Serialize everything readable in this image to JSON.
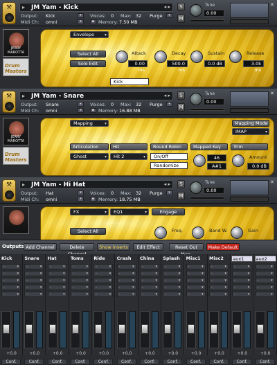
{
  "instruments": [
    {
      "title": "JM Yam - Kick",
      "output": "Kick",
      "midi_ch": "omni",
      "voices": "0",
      "max": "32",
      "purge": "Purge",
      "memory": "7.50 MB",
      "tune_label": "Tune",
      "tune_value": "0.00",
      "tab": "Envelope",
      "select_all": "Select All",
      "solo_edit": "Solo Edit",
      "slot_name": "Kick",
      "knobs": [
        {
          "label": "Attack",
          "value": "0.00 ms"
        },
        {
          "label": "Decay",
          "value": "500.0 ms"
        },
        {
          "label": "Sustain",
          "value": "0.0 dB"
        },
        {
          "label": "Release",
          "value": "3.0k ms"
        }
      ]
    },
    {
      "title": "JM Yam - Snare",
      "output": "Snare",
      "midi_ch": "omni",
      "voices": "0",
      "max": "32",
      "purge": "Purge",
      "memory": "16.88 MB",
      "tune_label": "Tune",
      "tune_value": "0.00",
      "tab": "Mapping",
      "mapping_mode_label": "Mapping Mode",
      "mapping_mode_value": "IMAP",
      "articulation_label": "Articulation",
      "articulation_value": "Ghost",
      "hit_label": "Hit",
      "hit_value": "Hit 2",
      "round_robin_label": "Round Robin",
      "on_off": "On/Off",
      "randomize": "Randomize",
      "mapped_key_label": "Mapped Key",
      "mapped_key_value": "46",
      "mapped_key_note": "A#1",
      "trim_label": "Trim",
      "trim_amount_label": "Amount",
      "trim_value": "0.0 dB"
    },
    {
      "title": "JM Yam - Hi Hat",
      "output": "Hat",
      "midi_ch": "omni",
      "voices": "0",
      "max": "32",
      "purge": "Purge",
      "memory": "18.75 MB",
      "tune_label": "Tune",
      "tune_value": "0.00",
      "fx_label": "FX",
      "fx_value": "EQ1",
      "engage": "Engage",
      "select_all": "Select All",
      "freq": "Freq.",
      "band_w": "Band W.",
      "gain": "Gain"
    }
  ],
  "header_labels": {
    "output": "Output:",
    "midi": "Midi Ch:",
    "voices": "Voices:",
    "max": "Max:",
    "memory": "Memory:",
    "s": "S",
    "m": "M"
  },
  "picture": {
    "caption1": "JERRY",
    "caption2": "MAROTTA",
    "logo_text": "Drum Masters"
  },
  "mixer": {
    "title": "Outputs",
    "buttons": [
      "Add Channel",
      "Delete Channel",
      "Show Inserts",
      "Edit Effect",
      "Reset Out Map.",
      "Make Default"
    ],
    "channels": [
      {
        "name": "Kick",
        "vol": "+0.0",
        "conf": "Conf."
      },
      {
        "name": "Snare",
        "vol": "+0.0",
        "conf": "Conf."
      },
      {
        "name": "Hat",
        "vol": "+0.0",
        "conf": "Conf."
      },
      {
        "name": "Toms",
        "vol": "+0.0",
        "conf": "Conf."
      },
      {
        "name": "Ride",
        "vol": "+0.0",
        "conf": "Conf."
      },
      {
        "name": "Crash",
        "vol": "+0.0",
        "conf": "Conf."
      },
      {
        "name": "China",
        "vol": "+0.0",
        "conf": "Conf."
      },
      {
        "name": "Splash",
        "vol": "+0.0",
        "conf": "Conf."
      },
      {
        "name": "Misc1",
        "vol": "+0.0",
        "conf": "Conf."
      },
      {
        "name": "Misc2",
        "vol": "+0.0",
        "conf": "Conf."
      },
      {
        "name": "aux1",
        "vol": "+0.0",
        "conf": "Conf."
      },
      {
        "name": "aux2",
        "vol": "+0.0",
        "conf": "Conf."
      }
    ]
  }
}
